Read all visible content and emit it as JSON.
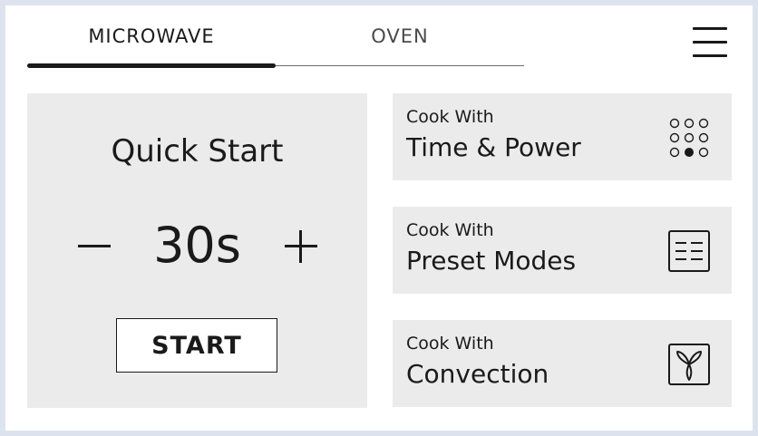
{
  "tabs": [
    {
      "label": "MICROWAVE",
      "active": true
    },
    {
      "label": "OVEN",
      "active": false
    }
  ],
  "menu": {
    "icon": "hamburger-menu-icon"
  },
  "quick_start": {
    "title": "Quick Start",
    "value": "30s",
    "start_label": "START"
  },
  "cook_options": [
    {
      "sub": "Cook With",
      "title": "Time & Power",
      "icon": "keypad-dots-icon"
    },
    {
      "sub": "Cook With",
      "title": "Preset Modes",
      "icon": "list-icon"
    },
    {
      "sub": "Cook With",
      "title": "Convection",
      "icon": "fan-icon"
    }
  ],
  "colors": {
    "frame": "#dde3ee",
    "panel": "#ebebeb",
    "text": "#1a1a1a",
    "background": "#ffffff"
  }
}
